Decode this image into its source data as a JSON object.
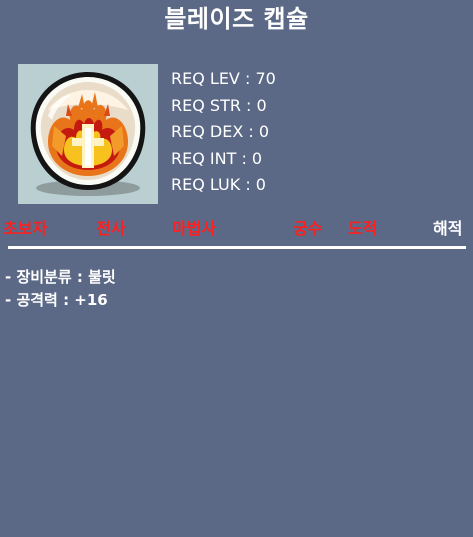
{
  "item": {
    "name": "블레이즈 캡슐"
  },
  "requirements": [
    {
      "text": "REQ LEV : 70"
    },
    {
      "text": "REQ STR : 0"
    },
    {
      "text": "REQ DEX : 0"
    },
    {
      "text": "REQ INT : 0"
    },
    {
      "text": "REQ LUK : 0"
    }
  ],
  "jobs": [
    {
      "label": "초보자",
      "color": "#ff1f1f",
      "allowed": false
    },
    {
      "label": "전사",
      "color": "#ff1f1f",
      "allowed": false
    },
    {
      "label": "마법사",
      "color": "#ff1f1f",
      "allowed": false
    },
    {
      "label": "궁수",
      "color": "#ff1f1f",
      "allowed": false
    },
    {
      "label": "도적",
      "color": "#ff1f1f",
      "allowed": false
    },
    {
      "label": "해적",
      "color": "#ffffff",
      "allowed": true
    }
  ],
  "details": [
    {
      "text": "- 장비분류 : 불릿"
    },
    {
      "text": "- 공격력 : +16"
    }
  ],
  "icon": {
    "name": "blaze-capsule-icon",
    "frame_color": "#b9cfd2"
  }
}
